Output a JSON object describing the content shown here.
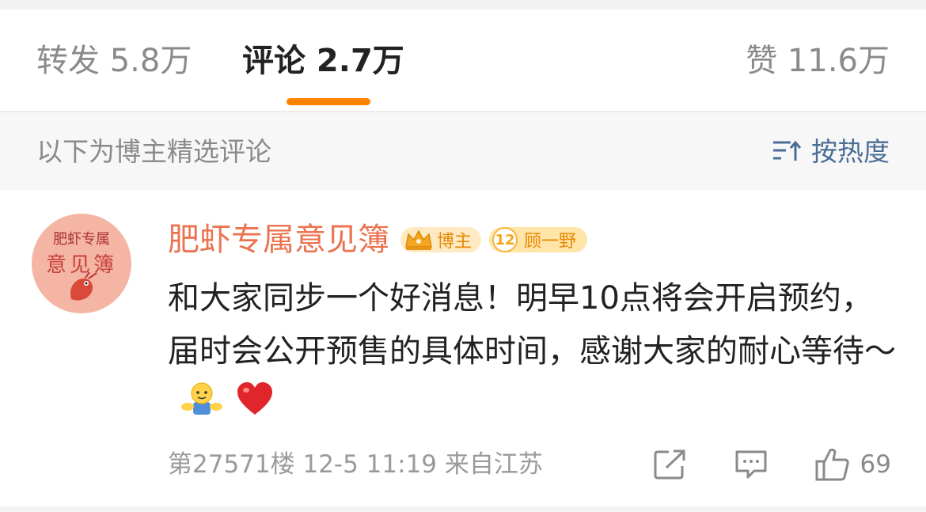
{
  "tabs": {
    "repost": "转发 5.8万",
    "comments": "评论 2.7万",
    "likes": "赞 11.6万"
  },
  "filter": {
    "caption": "以下为博主精选评论",
    "sort_label": "按热度"
  },
  "comment": {
    "avatar_text_line1": "肥虾专属",
    "avatar_text_line2": "意见簿",
    "username": "肥虾专属意见簿",
    "owner_badge": "博主",
    "fan_level": "12",
    "fan_badge_name": "顾一野",
    "text": "和大家同步一个好消息！明早10点将会开启预约，届时会公开预售的具体时间，感谢大家的耐心等待～",
    "meta": "第27571楼 12-5 11:19 来自江苏",
    "like_count": "69"
  },
  "colors": {
    "accent_orange": "#ff8200",
    "username": "#eb7350",
    "link_blue": "#4a6d95",
    "muted_text": "#8a8a8a",
    "heart": "#e0262b"
  },
  "icons": [
    "sort-icon",
    "crown-icon",
    "emoji-hug-icon",
    "heart-icon",
    "share-icon",
    "comment-icon",
    "like-icon"
  ]
}
